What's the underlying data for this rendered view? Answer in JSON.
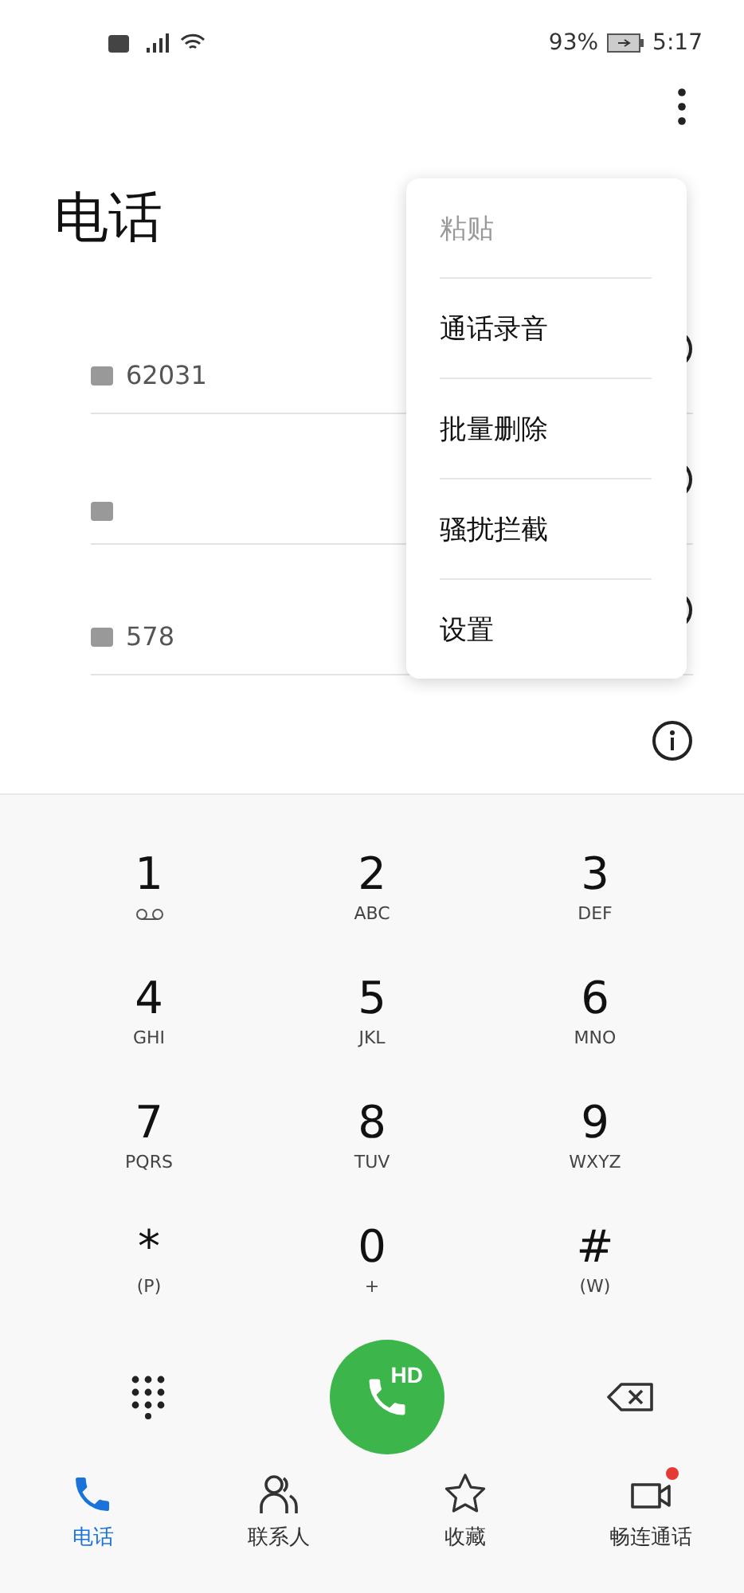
{
  "status_bar": {
    "battery": "93%",
    "time": "5:17"
  },
  "title": "电话",
  "calls": [
    {
      "hd": true,
      "number": "62031"
    },
    {
      "hd": true
    },
    {
      "hd": true,
      "number": "578"
    },
    {
      "hd": false
    }
  ],
  "menu": [
    {
      "label": "粘贴",
      "disabled": true
    },
    {
      "label": "通话录音",
      "disabled": false
    },
    {
      "label": "批量删除",
      "disabled": false
    },
    {
      "label": "骚扰拦截",
      "disabled": false
    },
    {
      "label": "设置",
      "disabled": false
    }
  ],
  "keypad": [
    {
      "digit": "1",
      "kind": "voicemail"
    },
    {
      "digit": "2",
      "letters": "ABC"
    },
    {
      "digit": "3",
      "letters": "DEF"
    },
    {
      "digit": "4",
      "letters": "GHI"
    },
    {
      "digit": "5",
      "letters": "JKL"
    },
    {
      "digit": "6",
      "letters": "MNO"
    },
    {
      "digit": "7",
      "letters": "PQRS"
    },
    {
      "digit": "8",
      "letters": "TUV"
    },
    {
      "digit": "9",
      "letters": "WXYZ"
    },
    {
      "digit": "*",
      "letters": "(P)"
    },
    {
      "digit": "0",
      "letters": "+"
    },
    {
      "digit": "#",
      "letters": "(W)"
    }
  ],
  "call_button": {
    "badge": "HD"
  },
  "nav": [
    {
      "kind": "phone",
      "label": "电话",
      "selected": true
    },
    {
      "kind": "contacts",
      "label": "联系人",
      "selected": false
    },
    {
      "kind": "favorites",
      "label": "收藏",
      "selected": false
    },
    {
      "kind": "video",
      "label": "畅连通话",
      "selected": false,
      "dot": true
    }
  ]
}
